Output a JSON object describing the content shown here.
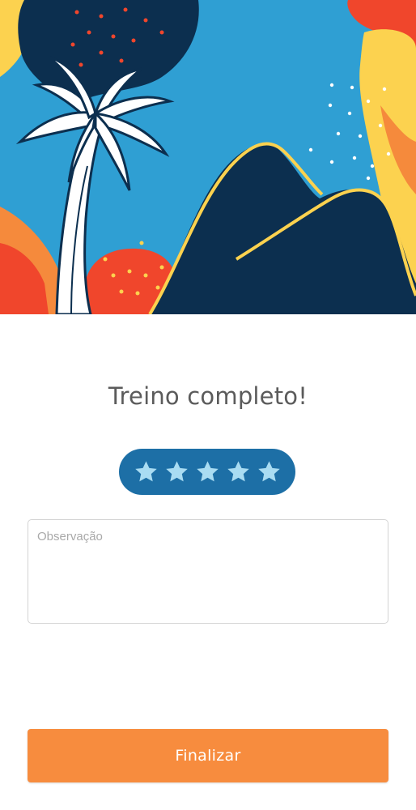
{
  "hero": {
    "illustration": "rio-palm-tree-mountains-illustration",
    "colors": {
      "sky": "#2f9fd3",
      "navy": "#0c2f4f",
      "yellow": "#fcd24f",
      "orange": "#f58a3c",
      "red": "#f0462c"
    }
  },
  "title": "Treino completo!",
  "rating": {
    "value": 5,
    "max": 5,
    "star_icon": "star-icon",
    "star_color": "#a9dcf2",
    "background": "#1d6fa6"
  },
  "observation": {
    "placeholder": "Observação",
    "value": ""
  },
  "finish_button": {
    "label": "Finalizar",
    "color": "#f78c3e"
  }
}
